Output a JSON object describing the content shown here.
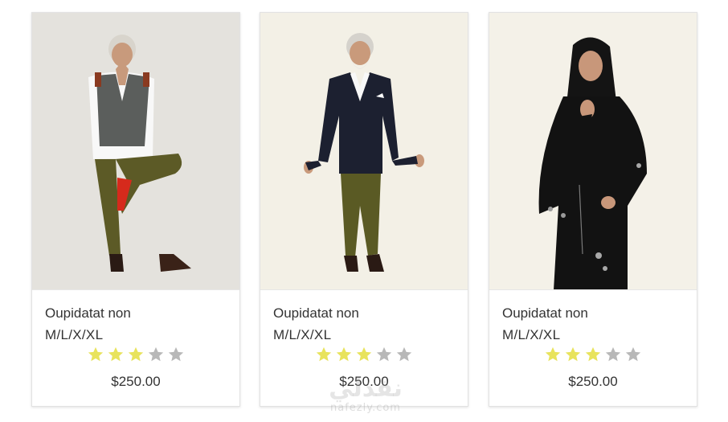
{
  "products": [
    {
      "title": "Oupidatat non",
      "sizes": "M/L/X/XL",
      "rating": 3,
      "rating_max": 5,
      "price": "$250.00",
      "image": "older-man-vest-yoga-pose-photo"
    },
    {
      "title": "Oupidatat non",
      "sizes": "M/L/X/XL",
      "rating": 3,
      "rating_max": 5,
      "price": "$250.00",
      "image": "older-man-blazer-walking-photo"
    },
    {
      "title": "Oupidatat non",
      "sizes": "M/L/X/XL",
      "rating": 3,
      "rating_max": 5,
      "price": "$250.00",
      "image": "woman-black-abaya-photo"
    }
  ],
  "watermark": {
    "arabic": "نفذلي",
    "latin": "nafezly.com"
  },
  "colors": {
    "star_filled": "#e8e35c",
    "star_empty": "#b8b8b8",
    "photo_bg_1": "#e4e2dd",
    "photo_bg_2": "#f3f0e6",
    "photo_bg_3": "#f4f1e8"
  }
}
